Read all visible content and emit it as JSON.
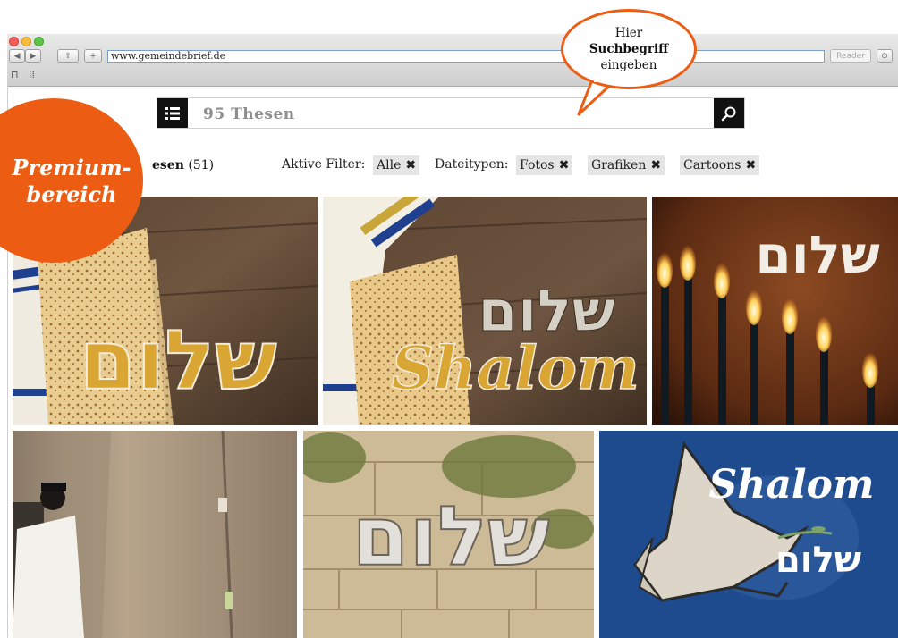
{
  "browser": {
    "url": "www.gemeindebrief.de",
    "reader_label": "Reader"
  },
  "search": {
    "query": "95 Thesen"
  },
  "results": {
    "label": "esen",
    "count": "(51)"
  },
  "filters": {
    "active_label": "Aktive Filter:",
    "active_chip": "Alle",
    "types_label": "Dateitypen:",
    "type_chips": [
      "Fotos",
      "Grafiken",
      "Cartoons"
    ]
  },
  "premium": {
    "line1": "Premium-",
    "line2": "bereich"
  },
  "callout": {
    "line1": "Hier",
    "line2": "Suchbegriff",
    "line3": "eingeben"
  },
  "images": {
    "shalom_hebrew": "שלום",
    "shalom_latin": "Shalom"
  },
  "colors": {
    "accent": "#ec5c12",
    "gold": "#d9a533",
    "dark": "#111111",
    "blue_tile": "#1e4b8e"
  }
}
